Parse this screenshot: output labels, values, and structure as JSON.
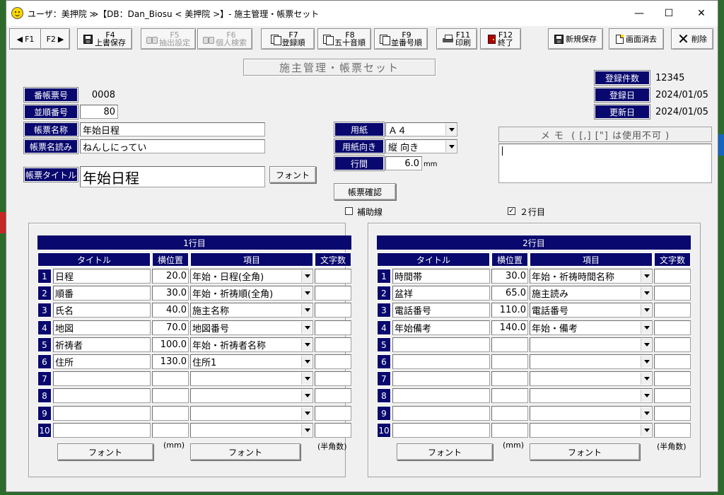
{
  "window": {
    "title": "ユーザ：美押院 ≫【DB：Dan_Biosu < 美押院 >】- 施主管理・帳票セット",
    "minimize": "—",
    "maximize": "☐",
    "close": "✕"
  },
  "toolbar": {
    "f1": "F1",
    "f2": "F2",
    "f4_key": "F4",
    "f4_label": "上書保存",
    "f5_key": "F5",
    "f5_label": "抽出設定",
    "f6_key": "F6",
    "f6_label": "個人検索",
    "f7_key": "F7",
    "f7_label": "登録順",
    "f8_key": "F8",
    "f8_label": "五十音順",
    "f9_key": "F9",
    "f9_label": "並番号順",
    "f11_key": "F11",
    "f11_label": "印刷",
    "f12_key": "F12",
    "f12_label": "終了",
    "new_save": "新規保存",
    "clear": "画面消去",
    "delete": "削除"
  },
  "banner": "施主管理・帳票セット",
  "stats": {
    "count_label": "登録件数",
    "count": "12345",
    "reg_label": "登録日",
    "reg_date": "2024/01/05",
    "upd_label": "更新日",
    "upd_date": "2024/01/05"
  },
  "form": {
    "form_no_label": "番帳票号",
    "form_no": "0008",
    "order_label": "並順番号",
    "order": "80",
    "name_label": "帳票名称",
    "name": "年始日程",
    "reading_label": "帳票名読み",
    "reading": "ねんしにってい",
    "title_label": "帳票タイトル",
    "title": "年始日程",
    "font_btn": "フォント",
    "paper_label": "用紙",
    "paper": "Ａ４",
    "orient_label": "用紙向き",
    "orient": "縦 向き",
    "spacing_label": "行間",
    "spacing": "6.0",
    "spacing_unit": "mm",
    "confirm_btn": "帳票確認",
    "guide_label": "補助線",
    "two_rows_label": "２行目",
    "two_rows_mark": "✓",
    "memo_header": "メ モ  ( [,] [\"] は使用不可 )"
  },
  "headers": {
    "title": "タイトル",
    "pos": "横位置",
    "item": "項目",
    "chars": "文字数"
  },
  "row1": {
    "heading": "1行目",
    "rows": [
      {
        "n": "1",
        "title": "日程",
        "pos": "20.0",
        "item": "年始・日程(全角)",
        "chars": ""
      },
      {
        "n": "2",
        "title": "順番",
        "pos": "30.0",
        "item": "年始・祈祷順(全角)",
        "chars": ""
      },
      {
        "n": "3",
        "title": "氏名",
        "pos": "40.0",
        "item": "施主名称",
        "chars": ""
      },
      {
        "n": "4",
        "title": "地図",
        "pos": "70.0",
        "item": "地図番号",
        "chars": ""
      },
      {
        "n": "5",
        "title": "祈祷者",
        "pos": "100.0",
        "item": "年始・祈祷者名称",
        "chars": ""
      },
      {
        "n": "6",
        "title": "住所",
        "pos": "130.0",
        "item": "住所1",
        "chars": ""
      },
      {
        "n": "7",
        "title": "",
        "pos": "",
        "item": "",
        "chars": ""
      },
      {
        "n": "8",
        "title": "",
        "pos": "",
        "item": "",
        "chars": ""
      },
      {
        "n": "9",
        "title": "",
        "pos": "",
        "item": "",
        "chars": ""
      },
      {
        "n": "10",
        "title": "",
        "pos": "",
        "item": "",
        "chars": ""
      }
    ],
    "font1": "フォント",
    "mm": "(mm)",
    "font2": "フォント",
    "halfwidth": "(半角数)"
  },
  "row2": {
    "heading": "2行目",
    "rows": [
      {
        "n": "1",
        "title": "時間帯",
        "pos": "30.0",
        "item": "年始・祈祷時間名称",
        "chars": ""
      },
      {
        "n": "2",
        "title": "盆祥",
        "pos": "65.0",
        "item": "施主読み",
        "chars": ""
      },
      {
        "n": "3",
        "title": "電話番号",
        "pos": "110.0",
        "item": "電話番号",
        "chars": ""
      },
      {
        "n": "4",
        "title": "年始備考",
        "pos": "140.0",
        "item": "年始・備考",
        "chars": ""
      },
      {
        "n": "5",
        "title": "",
        "pos": "",
        "item": "",
        "chars": ""
      },
      {
        "n": "6",
        "title": "",
        "pos": "",
        "item": "",
        "chars": ""
      },
      {
        "n": "7",
        "title": "",
        "pos": "",
        "item": "",
        "chars": ""
      },
      {
        "n": "8",
        "title": "",
        "pos": "",
        "item": "",
        "chars": ""
      },
      {
        "n": "9",
        "title": "",
        "pos": "",
        "item": "",
        "chars": ""
      },
      {
        "n": "10",
        "title": "",
        "pos": "",
        "item": "",
        "chars": ""
      }
    ],
    "font1": "フォント",
    "mm": "(mm)",
    "font2": "フォント",
    "halfwidth": "(半角数)"
  }
}
